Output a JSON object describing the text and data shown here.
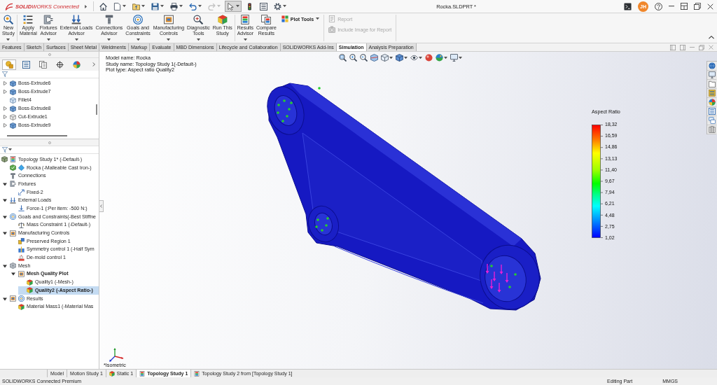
{
  "title_bar": {
    "logo": "**SOLID**WORKS Connected",
    "document_title": "Rocka.SLDPRT *",
    "avatar": "JH"
  },
  "quick_access": [
    {
      "kind": "home",
      "dropdown": false,
      "pressed": false,
      "disabled": false
    },
    {
      "kind": "new",
      "dropdown": true,
      "pressed": false,
      "disabled": false
    },
    {
      "kind": "open",
      "dropdown": true,
      "pressed": false,
      "disabled": false
    },
    {
      "kind": "save",
      "dropdown": true,
      "pressed": false,
      "disabled": false
    },
    {
      "kind": "print",
      "dropdown": true,
      "pressed": false,
      "disabled": false
    },
    {
      "kind": "undo",
      "dropdown": true,
      "pressed": false,
      "disabled": false
    },
    {
      "kind": "redo",
      "dropdown": true,
      "pressed": false,
      "disabled": true
    },
    {
      "kind": "select",
      "dropdown": true,
      "pressed": true,
      "disabled": false
    },
    {
      "kind": "rebuild",
      "dropdown": false,
      "pressed": false,
      "disabled": false
    },
    {
      "kind": "file-properties",
      "dropdown": false,
      "pressed": false,
      "disabled": false
    },
    {
      "kind": "options",
      "dropdown": true,
      "pressed": false,
      "disabled": false
    }
  ],
  "ribbon": {
    "groups": [
      {
        "buttons": [
          {
            "kind": "new-study",
            "compact": false,
            "lines": [
              "New",
              "Study"
            ],
            "dropdown": true,
            "disabled": false
          }
        ]
      },
      {
        "buttons": [
          {
            "kind": "apply-material",
            "compact": false,
            "lines": [
              "Apply",
              "Material"
            ],
            "dropdown": false,
            "disabled": false
          },
          {
            "kind": "fixtures",
            "compact": false,
            "lines": [
              "Fixtures",
              "Advisor"
            ],
            "dropdown": true,
            "disabled": false
          },
          {
            "kind": "external-loads",
            "compact": false,
            "lines": [
              "External Loads",
              "Advisor"
            ],
            "dropdown": true,
            "disabled": false
          },
          {
            "kind": "connections",
            "compact": false,
            "lines": [
              "Connections",
              "Advisor"
            ],
            "dropdown": true,
            "disabled": false
          },
          {
            "kind": "goals",
            "compact": false,
            "lines": [
              "Goals and",
              "Constraints"
            ],
            "dropdown": true,
            "disabled": false
          },
          {
            "kind": "manufacturing",
            "compact": false,
            "lines": [
              "Manufacturing",
              "Controls"
            ],
            "dropdown": true,
            "disabled": false
          },
          {
            "kind": "diagnostic",
            "compact": false,
            "lines": [
              "Diagnostic",
              "Tools"
            ],
            "dropdown": true,
            "disabled": false
          },
          {
            "kind": "run",
            "compact": false,
            "lines": [
              "Run This",
              "Study"
            ],
            "dropdown": false,
            "disabled": false
          }
        ]
      },
      {
        "buttons": [
          {
            "kind": "results-advisor",
            "compact": false,
            "lines": [
              "Results",
              "Advisor"
            ],
            "dropdown": true,
            "disabled": false
          },
          {
            "kind": "compare",
            "compact": false,
            "lines": [
              "Compare",
              "Results"
            ],
            "dropdown": false,
            "disabled": false
          },
          {
            "kind": "plot-tools",
            "compact": true,
            "lines": [
              "Plot Tools"
            ],
            "dropdown": true,
            "disabled": false
          }
        ]
      },
      {
        "buttons": [
          {
            "kind": "report",
            "compact": true,
            "lines": [
              "Report"
            ],
            "dropdown": false,
            "disabled": true
          },
          {
            "kind": "include-image",
            "compact": true,
            "lines": [
              "Include Image for Report"
            ],
            "dropdown": false,
            "disabled": true
          }
        ]
      }
    ]
  },
  "command_tabs": [
    {
      "label": "Features",
      "selected": false
    },
    {
      "label": "Sketch",
      "selected": false
    },
    {
      "label": "Surfaces",
      "selected": false
    },
    {
      "label": "Sheet Metal",
      "selected": false
    },
    {
      "label": "Weldments",
      "selected": false
    },
    {
      "label": "Markup",
      "selected": false
    },
    {
      "label": "Evaluate",
      "selected": false
    },
    {
      "label": "MBD Dimensions",
      "selected": false
    },
    {
      "label": "Lifecycle and Collaboration",
      "selected": false
    },
    {
      "label": "SOLIDWORKS Add-Ins",
      "selected": false
    },
    {
      "label": "Simulation",
      "selected": true
    },
    {
      "label": "Analysis Preparation",
      "selected": false
    }
  ],
  "panel_tabs": [
    {
      "kind": "feature-manager",
      "selected": true
    },
    {
      "kind": "property-manager",
      "selected": false
    },
    {
      "kind": "configuration-manager",
      "selected": false
    },
    {
      "kind": "dimxpert",
      "selected": false
    },
    {
      "kind": "display-manager",
      "selected": false
    }
  ],
  "feature_tree": [
    {
      "label": "Boss-Extrude6",
      "kind": "boss",
      "expandable": true,
      "expanded": false,
      "selected": false
    },
    {
      "label": "Boss-Extrude7",
      "kind": "boss",
      "expandable": true,
      "expanded": false,
      "selected": false
    },
    {
      "label": "Fillet4",
      "kind": "fillet",
      "expandable": false,
      "selected": false
    },
    {
      "label": "Boss-Extrude8",
      "kind": "boss",
      "expandable": true,
      "expanded": false,
      "selected": false
    },
    {
      "label": "Cut-Extrude1",
      "kind": "cut",
      "expandable": true,
      "expanded": false,
      "selected": false
    },
    {
      "label": "Boss-Extrude9",
      "kind": "boss",
      "expandable": true,
      "expanded": false,
      "selected": false
    }
  ],
  "simulation_tree": [
    {
      "label": "Topology Study 1* (-Default-)",
      "kind": "study",
      "expandable": false,
      "selected": false,
      "active": false
    },
    {
      "label": "Rocka (-Malleable Cast Iron-)",
      "kind": "part",
      "expandable": false,
      "selected": false,
      "active": false
    },
    {
      "label": "Connections",
      "kind": "connections",
      "expandable": false,
      "selected": false,
      "active": false
    },
    {
      "label": "Fixtures",
      "kind": "fixtures",
      "expandable": true,
      "expanded": true,
      "selected": false,
      "active": false,
      "children": [
        {
          "label": "Fixed-2",
          "kind": "fixed",
          "expandable": false,
          "selected": false,
          "active": false
        }
      ]
    },
    {
      "label": "External Loads",
      "kind": "loads",
      "expandable": true,
      "expanded": true,
      "selected": false,
      "active": false,
      "children": [
        {
          "label": "Force-1 (:Per item: -500 N:)",
          "kind": "force",
          "expandable": false,
          "selected": false,
          "active": false
        }
      ]
    },
    {
      "label": "Goals and Constraints(-Best Stiffne",
      "kind": "goals",
      "expandable": true,
      "expanded": true,
      "selected": false,
      "active": false,
      "children": [
        {
          "label": "Mass Constraint 1 (-Default-)",
          "kind": "mass-constraint",
          "expandable": false,
          "selected": false,
          "active": false
        }
      ]
    },
    {
      "label": "Manufacturing Controls",
      "kind": "manufacturing",
      "expandable": true,
      "expanded": true,
      "selected": false,
      "active": false,
      "children": [
        {
          "label": "Preserved Region 1",
          "kind": "preserved",
          "expandable": false,
          "selected": false,
          "active": false
        },
        {
          "label": "Symmetry control 1 (-Half Sym",
          "kind": "symmetry",
          "expandable": false,
          "selected": false,
          "active": false
        },
        {
          "label": "De-mold control 1",
          "kind": "demold",
          "expandable": false,
          "selected": false,
          "active": false
        }
      ]
    },
    {
      "label": "Mesh",
      "kind": "mesh",
      "expandable": true,
      "expanded": true,
      "selected": false,
      "active": false,
      "children": [
        {
          "label": "Mesh Quality Plot",
          "kind": "plot-folder",
          "expandable": true,
          "expanded": true,
          "selected": false,
          "active": true,
          "children": [
            {
              "label": "Quality1 (-Mesh-)",
              "kind": "plot",
              "expandable": false,
              "selected": false,
              "active": false
            },
            {
              "label": "Quality2 (-Aspect Ratio-)",
              "kind": "plot",
              "expandable": false,
              "selected": true,
              "active": true
            }
          ]
        }
      ]
    },
    {
      "label": "Results",
      "kind": "results",
      "expandable": true,
      "expanded": true,
      "selected": false,
      "active": false,
      "children": [
        {
          "label": "Material Mass1 (-Material Mas",
          "kind": "plot",
          "expandable": false,
          "selected": false,
          "active": false
        }
      ]
    }
  ],
  "viewport": {
    "info": [
      "Model name: Rocka",
      "Study name: Topology Study 1(-Default-)",
      "Plot type: Aspect ratio Quality2"
    ],
    "legend": {
      "title": "Aspect Ratio",
      "labels": [
        "18,32",
        "16,59",
        "14,86",
        "13,13",
        "11,40",
        "9,67",
        "7,94",
        "6,21",
        "4,48",
        "2,75",
        "1,02"
      ]
    },
    "view_name": "*Isometric"
  },
  "bottom_tabs": [
    {
      "label": "Model",
      "kind": "model",
      "selected": false
    },
    {
      "label": "Motion Study 1",
      "kind": "motion",
      "selected": false
    },
    {
      "label": "Static 1",
      "kind": "static",
      "selected": false
    },
    {
      "label": "Topology Study 1",
      "kind": "topology",
      "selected": true
    },
    {
      "label": "Topology Study 2 from [Topology Study 1]",
      "kind": "topology",
      "selected": false
    }
  ],
  "status_bar": {
    "product": "SOLIDWORKS Connected Premium",
    "mode": "Editing Part",
    "units": "MMGS"
  }
}
